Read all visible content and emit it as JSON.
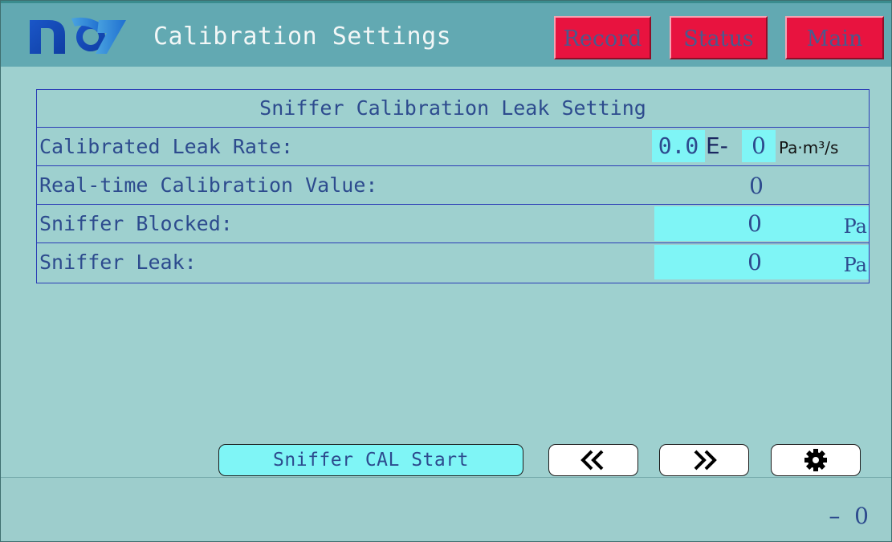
{
  "header": {
    "title": "Calibration Settings",
    "buttons": {
      "record": "Record",
      "status": "Status",
      "main": "Main"
    },
    "colors": {
      "header_bg": "#62a9b2",
      "button_bg": "#e8133f",
      "button_text": "#4a5a8e"
    }
  },
  "table": {
    "title": "Sniffer Calibration Leak Setting",
    "calibrated_leak_rate": {
      "label": "Calibrated Leak Rate:",
      "mantissa": "0.0",
      "exp_sep": "E-",
      "exponent": "0",
      "unit": "Pa·m³/s"
    },
    "realtime_value": {
      "label": "Real-time Calibration Value:",
      "value": "0"
    },
    "sniffer_blocked": {
      "label": "Sniffer Blocked:",
      "value": "0",
      "unit": "Pa"
    },
    "sniffer_leak": {
      "label": "Sniffer Leak:",
      "value": "0",
      "unit": "Pa"
    }
  },
  "controls": {
    "cal_start": "Sniffer CAL Start",
    "prev_icon": "double-chevron-left-icon",
    "next_icon": "double-chevron-right-icon",
    "settings_icon": "gear-icon"
  },
  "footer": {
    "status_value": "–  0"
  },
  "colors": {
    "background": "#9ed0cf",
    "input_cyan": "#7ff5f6",
    "table_border": "#2b3cb6",
    "text": "#2d4b8e"
  }
}
